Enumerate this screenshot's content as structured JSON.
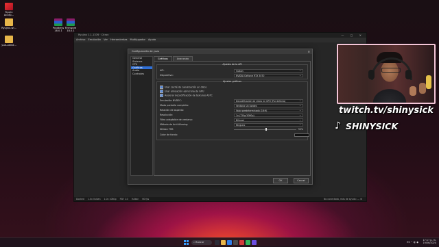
{
  "desktop": {
    "icons": [
      {
        "label": "Ryujin\nAccep...",
        "kind": "app-red"
      },
      {
        "label": "Ryujinx-wi...",
        "kind": "folder"
      },
      {
        "label": "Prodkeys\n18.0.1",
        "kind": "winrar"
      },
      {
        "label": "Firmware\n18.0.1",
        "kind": "winrar"
      },
      {
        "label": "yuzu-wind...",
        "kind": "folder"
      }
    ]
  },
  "emulator": {
    "title": "Ryujinx 1.1.1376 · Citron",
    "window_controls": "— ▢ ✕",
    "menu": [
      "Archivo",
      "Emulación",
      "Ver",
      "Herramientas",
      "Multijugador",
      "Ayuda"
    ],
    "status": {
      "left": [
        "Docked",
        "1.0x  Vulkan",
        "1.0x 1080p",
        "FSR 1.0",
        "Vulkan",
        "60 fps"
      ],
      "right": "No conectado, más de ayuda: --- ⚙"
    }
  },
  "dialog": {
    "title": "Configuración de yuzu",
    "close": "✕",
    "sidebar": [
      "General",
      "Sistema",
      "CPU",
      "Gráficos",
      "Audio",
      "Controles"
    ],
    "selected_sidebar_index": 3,
    "tabs": [
      "Gráficos",
      "Avanzado"
    ],
    "active_tab": 0,
    "api_group": {
      "title": "Ajustes de la API",
      "rows": [
        {
          "label": "API:",
          "value": "Vulkan"
        },
        {
          "label": "Dispositivo:",
          "value": "NVIDIA GeForce RTX 3070"
        }
      ]
    },
    "graphics_group": {
      "title": "Ajustes gráficos",
      "checkboxes": [
        {
          "label": "Usar caché de canalización en disco",
          "checked": true
        },
        {
          "label": "Usar emulación asíncrona de GPU",
          "checked": true
        },
        {
          "label": "Acelerar decodificación de texturas ASTC",
          "checked": true
        }
      ],
      "rows": [
        {
          "label": "Emulación NVDEC:",
          "value": "Decodificación de vídeo en GPU (Por defecto)"
        },
        {
          "label": "Modo pantalla completa:",
          "value": "Ventana sin bordes"
        },
        {
          "label": "Relación de aspecto:",
          "value": "Valor predeterminado (16:9)"
        },
        {
          "label": "Resolución:",
          "value": "1x (720p/1080p)"
        },
        {
          "label": "Filtro adaptable de ventana:",
          "value": "Bilineal"
        },
        {
          "label": "Método de Anti-Aliasing:",
          "value": "Ninguno"
        }
      ],
      "fsr": {
        "label": "Nitidez FSR:",
        "value": "50%",
        "level": 0.5
      },
      "bg_color": {
        "label": "Color de fondo:",
        "swatch": "#111111"
      }
    },
    "buttons": {
      "ok": "OK",
      "cancel": "Cancel"
    }
  },
  "overlay": {
    "twitch": "twitch.tv/shinysick",
    "tiktok": "SHINYSICK",
    "tiktok_icon": "tiktok-icon"
  },
  "taskbar": {
    "search_placeholder": "Buscar",
    "tray": "ES  ⌃ ◐ ◆",
    "time": "17:17 p. m.",
    "date": "19/06/2024"
  },
  "colors": {
    "accent": "#2f6fd6",
    "wallpaper_glow": "#ff5028"
  }
}
